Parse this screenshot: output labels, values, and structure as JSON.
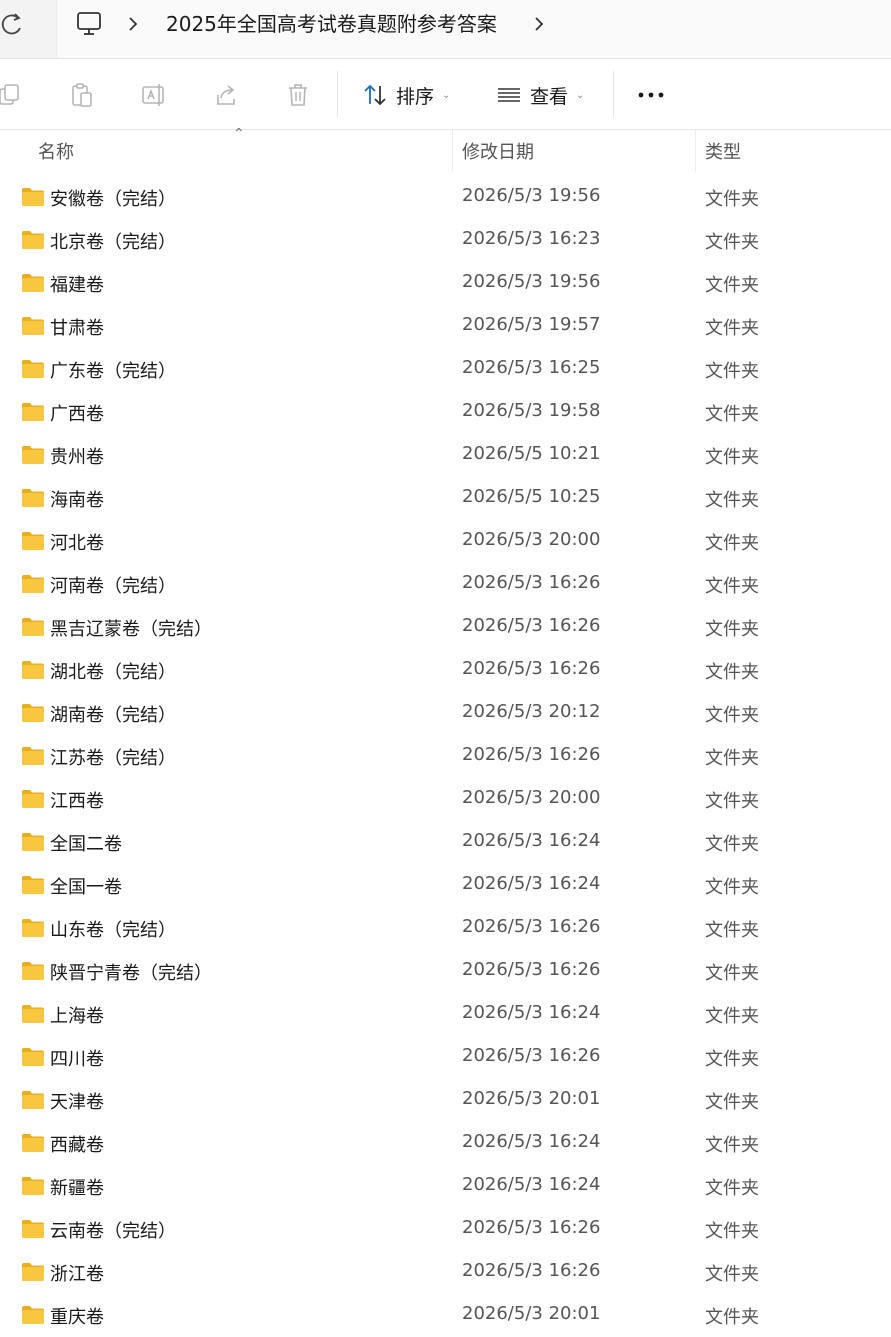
{
  "address_bar": {
    "refresh_icon": "refresh-icon",
    "pc_icon": "this-pc-icon",
    "breadcrumb": "2025年全国高考试卷真题附参考答案"
  },
  "toolbar": {
    "sort_label": "排序",
    "view_label": "查看",
    "more_label": "•••",
    "icons": [
      "copy-icon",
      "paste-icon",
      "rename-icon",
      "share-icon",
      "delete-icon"
    ]
  },
  "columns": {
    "name": "名称",
    "date": "修改日期",
    "type": "类型"
  },
  "files": [
    {
      "name": "安徽卷（完结）",
      "date": "2026/5/3 19:56",
      "type": "文件夹"
    },
    {
      "name": "北京卷（完结）",
      "date": "2026/5/3 16:23",
      "type": "文件夹"
    },
    {
      "name": "福建卷",
      "date": "2026/5/3 19:56",
      "type": "文件夹"
    },
    {
      "name": "甘肃卷",
      "date": "2026/5/3 19:57",
      "type": "文件夹"
    },
    {
      "name": "广东卷（完结）",
      "date": "2026/5/3 16:25",
      "type": "文件夹"
    },
    {
      "name": "广西卷",
      "date": "2026/5/3 19:58",
      "type": "文件夹"
    },
    {
      "name": "贵州卷",
      "date": "2026/5/5 10:21",
      "type": "文件夹"
    },
    {
      "name": "海南卷",
      "date": "2026/5/5 10:25",
      "type": "文件夹"
    },
    {
      "name": "河北卷",
      "date": "2026/5/3 20:00",
      "type": "文件夹"
    },
    {
      "name": "河南卷（完结）",
      "date": "2026/5/3 16:26",
      "type": "文件夹"
    },
    {
      "name": "黑吉辽蒙卷（完结）",
      "date": "2026/5/3 16:26",
      "type": "文件夹"
    },
    {
      "name": "湖北卷（完结）",
      "date": "2026/5/3 16:26",
      "type": "文件夹"
    },
    {
      "name": "湖南卷（完结）",
      "date": "2026/5/3 20:12",
      "type": "文件夹"
    },
    {
      "name": "江苏卷（完结）",
      "date": "2026/5/3 16:26",
      "type": "文件夹"
    },
    {
      "name": "江西卷",
      "date": "2026/5/3 20:00",
      "type": "文件夹"
    },
    {
      "name": "全国二卷",
      "date": "2026/5/3 16:24",
      "type": "文件夹"
    },
    {
      "name": "全国一卷",
      "date": "2026/5/3 16:24",
      "type": "文件夹"
    },
    {
      "name": "山东卷（完结）",
      "date": "2026/5/3 16:26",
      "type": "文件夹"
    },
    {
      "name": "陕晋宁青卷（完结）",
      "date": "2026/5/3 16:26",
      "type": "文件夹"
    },
    {
      "name": "上海卷",
      "date": "2026/5/3 16:24",
      "type": "文件夹"
    },
    {
      "name": "四川卷",
      "date": "2026/5/3 16:26",
      "type": "文件夹"
    },
    {
      "name": "天津卷",
      "date": "2026/5/3 20:01",
      "type": "文件夹"
    },
    {
      "name": "西藏卷",
      "date": "2026/5/3 16:24",
      "type": "文件夹"
    },
    {
      "name": "新疆卷",
      "date": "2026/5/3 16:24",
      "type": "文件夹"
    },
    {
      "name": "云南卷（完结）",
      "date": "2026/5/3 16:26",
      "type": "文件夹"
    },
    {
      "name": "浙江卷",
      "date": "2026/5/3 16:26",
      "type": "文件夹"
    },
    {
      "name": "重庆卷",
      "date": "2026/5/3 20:01",
      "type": "文件夹"
    }
  ],
  "colors": {
    "folder_fill": "#f9c73f",
    "folder_tab": "#e9ad1e",
    "icon_gray": "#b5b5b5",
    "accent_blue": "#1f6fb2"
  }
}
